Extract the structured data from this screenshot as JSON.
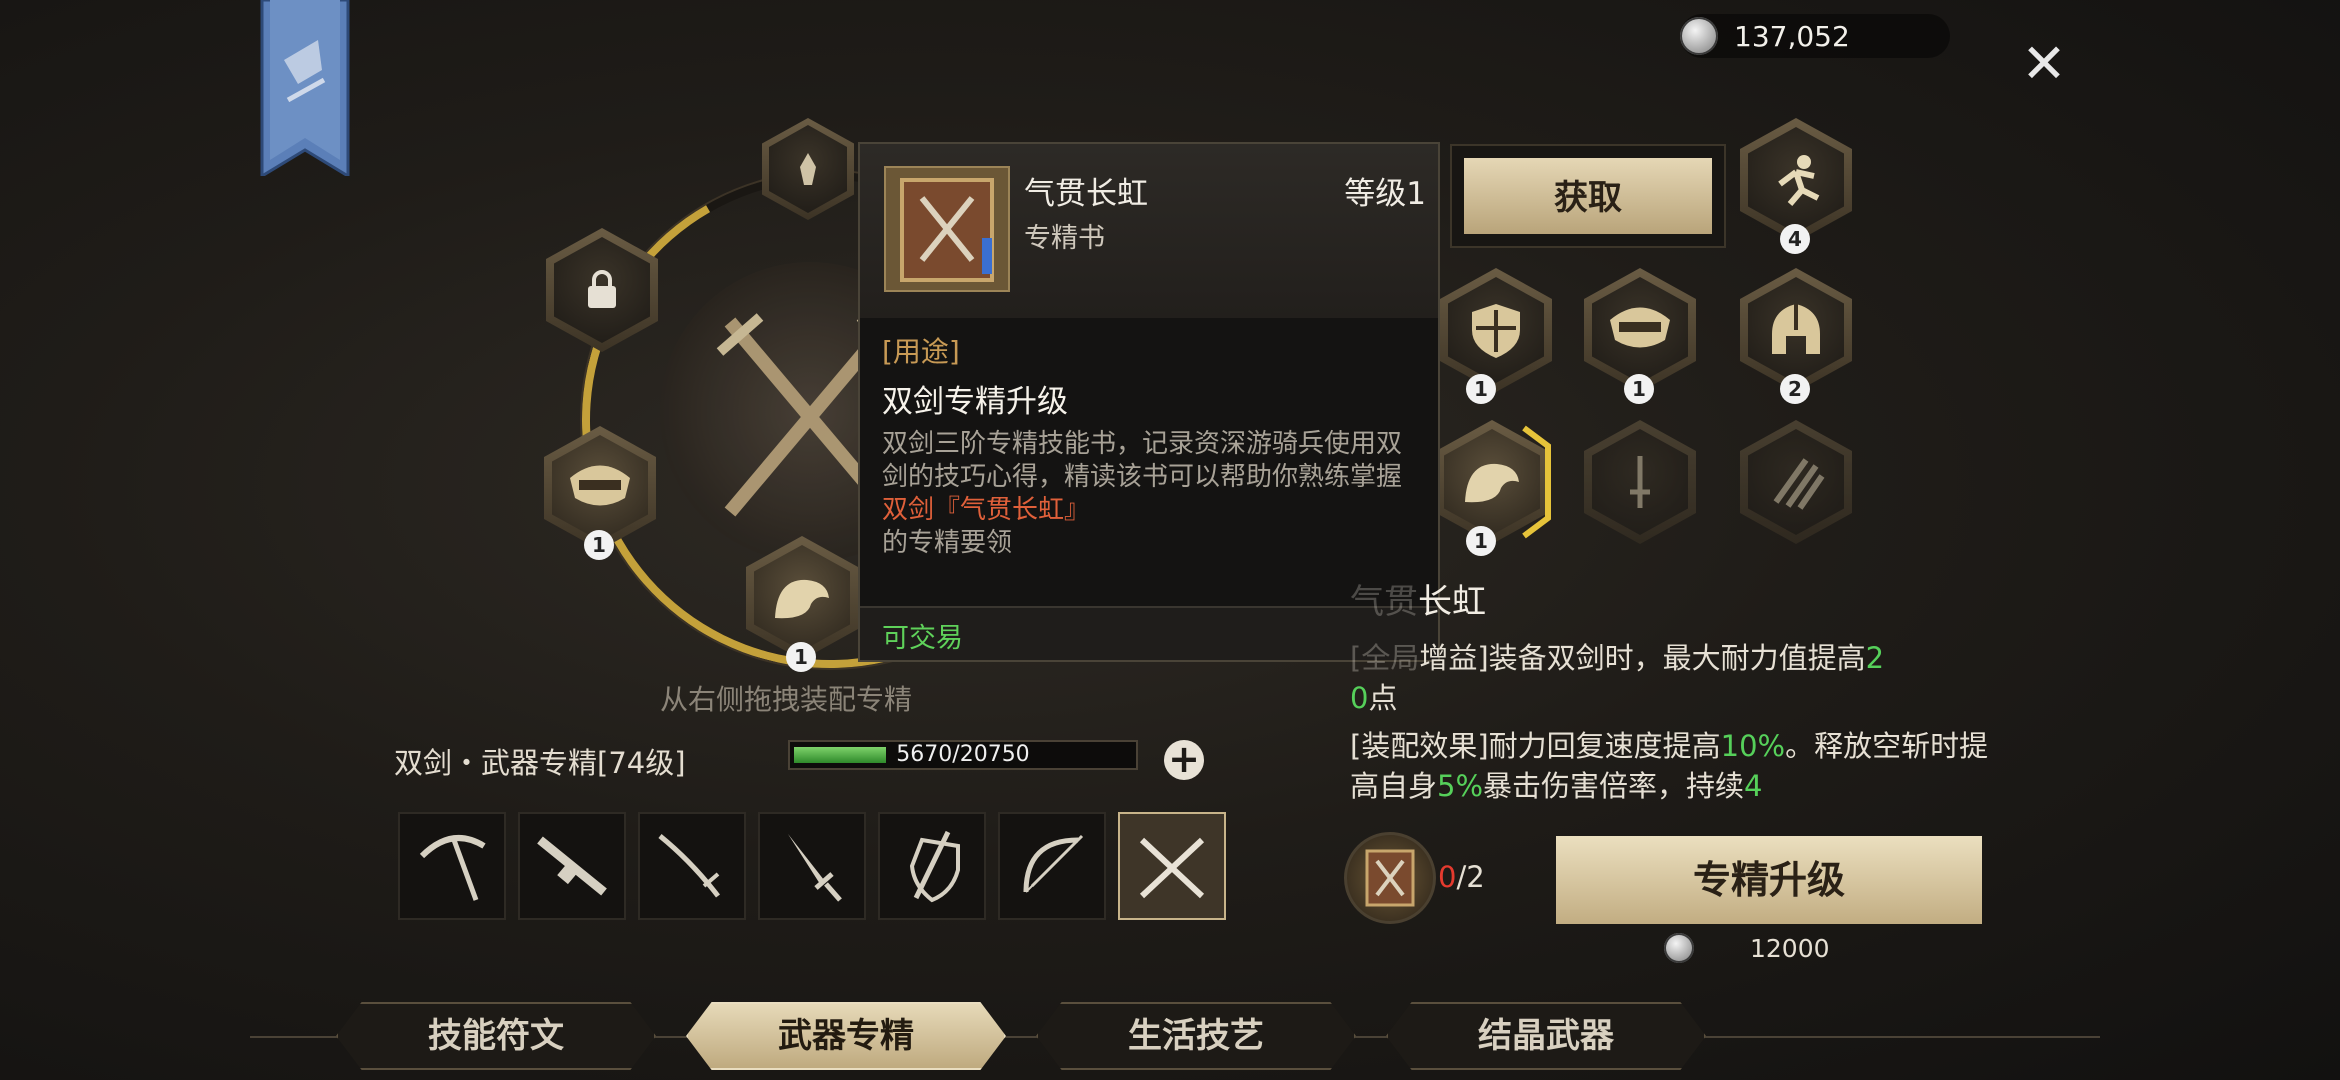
{
  "currency": {
    "amount": "137,052",
    "icon": "silver-coin-icon"
  },
  "tooltip": {
    "name": "气贯长虹",
    "level": "等级1",
    "type": "专精书",
    "use_label": "[用途]",
    "use_title": "双剑专精升级",
    "desc_main": "双剑三阶专精技能书，记录资深游骑兵使用双剑的技巧心得，精读该书可以帮助你熟练掌握",
    "desc_highlight": "双剑『气贯长虹』",
    "desc_end": "的专精要领",
    "tradable": "可交易"
  },
  "obtain_label": "获取",
  "wheel": {
    "hint": "从右侧拖拽装配专精",
    "badges": [
      "1",
      "1"
    ]
  },
  "grid_badges": {
    "r1c3": "4",
    "r2c1": "1",
    "r2c2": "1",
    "r2c3": "2",
    "r3c1": "1"
  },
  "spec": {
    "label": "双剑・武器专精[74级]",
    "xp_text": "5670/20750",
    "xp_fraction": 0.273
  },
  "weapons": [
    "scythe",
    "rifle",
    "katana",
    "dagger",
    "shield-sword",
    "bow",
    "dual-swords"
  ],
  "skill": {
    "title_tail": "长虹",
    "line1_label": "增益]装备双剑时，最大耐力值提高",
    "line1_value": "2",
    "line1_value_b": "0",
    "line1_suffix": "点",
    "line2_label": "[装配效果]耐力回复速度提高",
    "line2_pct1": "10%",
    "line2_mid": "。释放空斩时提高自身",
    "line2_pct2": "5%",
    "line2_end": "暴击伤害倍率，持续",
    "line2_num": "4"
  },
  "book": {
    "have": "0",
    "need": "/2"
  },
  "upgrade_label": "专精升级",
  "upgrade_cost": "12000",
  "tabs": [
    "技能符文",
    "武器专精",
    "生活技艺",
    "结晶武器"
  ],
  "colors": {
    "gold_accent": "#c4a13a",
    "green": "#56d05a",
    "red": "#e53a2e",
    "highlight": "#e0603a"
  }
}
